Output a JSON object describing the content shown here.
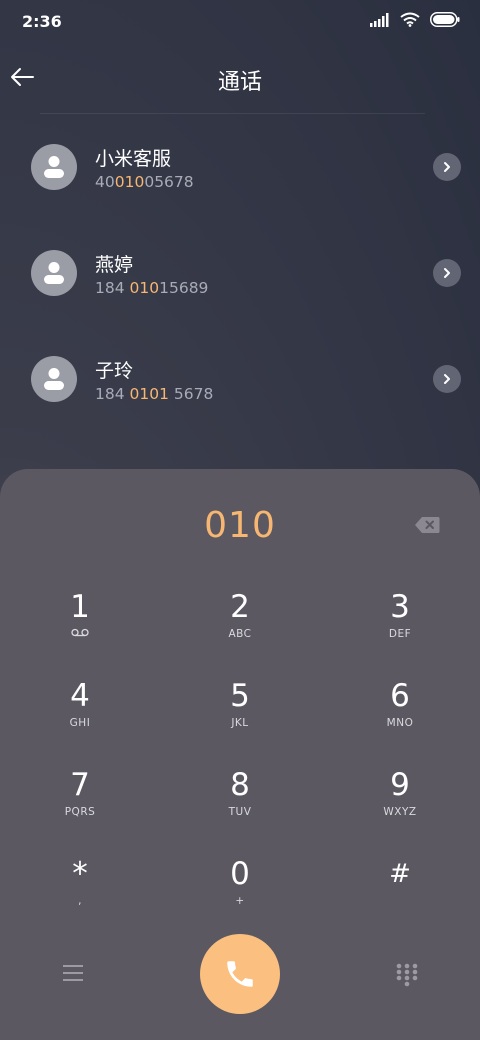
{
  "status": {
    "time": "2:36"
  },
  "header": {
    "title": "通话"
  },
  "contacts": [
    {
      "name": "小米客服",
      "number_pre": "40",
      "number_hl": "010",
      "number_post": "05678"
    },
    {
      "name": "燕婷",
      "number_pre": "184 ",
      "number_hl": "010",
      "number_post": "15689"
    },
    {
      "name": "子玲",
      "number_pre": "184 ",
      "number_hl": "0101",
      "number_post": " 5678"
    }
  ],
  "dialpad": {
    "number": "010",
    "keys": [
      {
        "digit": "1",
        "letters": ""
      },
      {
        "digit": "2",
        "letters": "ABC"
      },
      {
        "digit": "3",
        "letters": "DEF"
      },
      {
        "digit": "4",
        "letters": "GHI"
      },
      {
        "digit": "5",
        "letters": "JKL"
      },
      {
        "digit": "6",
        "letters": "MNO"
      },
      {
        "digit": "7",
        "letters": "PQRS"
      },
      {
        "digit": "8",
        "letters": "TUV"
      },
      {
        "digit": "9",
        "letters": "WXYZ"
      },
      {
        "digit": "*",
        "letters": ","
      },
      {
        "digit": "0",
        "letters": "+"
      },
      {
        "digit": "#",
        "letters": ""
      }
    ]
  },
  "colors": {
    "accent": "#f7b772",
    "call_button": "#fbc07f",
    "panel": "#5b5862"
  },
  "icons": {
    "back": "arrow-left-icon",
    "chevron": "chevron-right-icon",
    "backspace": "backspace-icon",
    "voicemail": "voicemail-icon",
    "menu": "menu-icon",
    "call": "phone-icon",
    "keypad": "keypad-icon"
  }
}
